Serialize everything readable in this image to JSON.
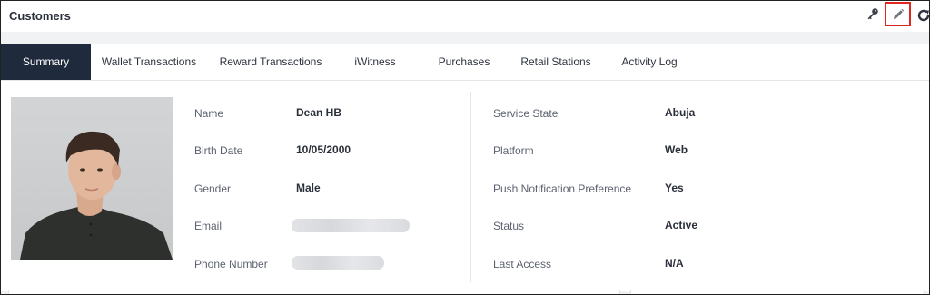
{
  "header": {
    "title": "Customers",
    "icons": [
      "key-icon",
      "pencil-icon",
      "refresh-icon"
    ]
  },
  "tabs": [
    {
      "label": "Summary",
      "active": true
    },
    {
      "label": "Wallet Transactions",
      "active": false
    },
    {
      "label": "Reward Transactions",
      "active": false
    },
    {
      "label": "iWitness",
      "active": false
    },
    {
      "label": "Purchases",
      "active": false
    },
    {
      "label": "Retail Stations",
      "active": false
    },
    {
      "label": "Activity Log",
      "active": false
    }
  ],
  "profile": {
    "left_fields": [
      {
        "label": "Name",
        "value": "Dean HB"
      },
      {
        "label": "Birth Date",
        "value": "10/05/2000"
      },
      {
        "label": "Gender",
        "value": "Male"
      },
      {
        "label": "Email",
        "value": ""
      },
      {
        "label": "Phone Number",
        "value": ""
      }
    ],
    "right_fields": [
      {
        "label": "Service State",
        "value": "Abuja"
      },
      {
        "label": "Platform",
        "value": "Web"
      },
      {
        "label": "Push Notification Preference",
        "value": "Yes"
      },
      {
        "label": "Status",
        "value": "Active"
      },
      {
        "label": "Last Access",
        "value": "N/A"
      }
    ]
  },
  "colors": {
    "active_tab_bg": "#1f2a3d",
    "highlight_border": "#e0261f"
  }
}
